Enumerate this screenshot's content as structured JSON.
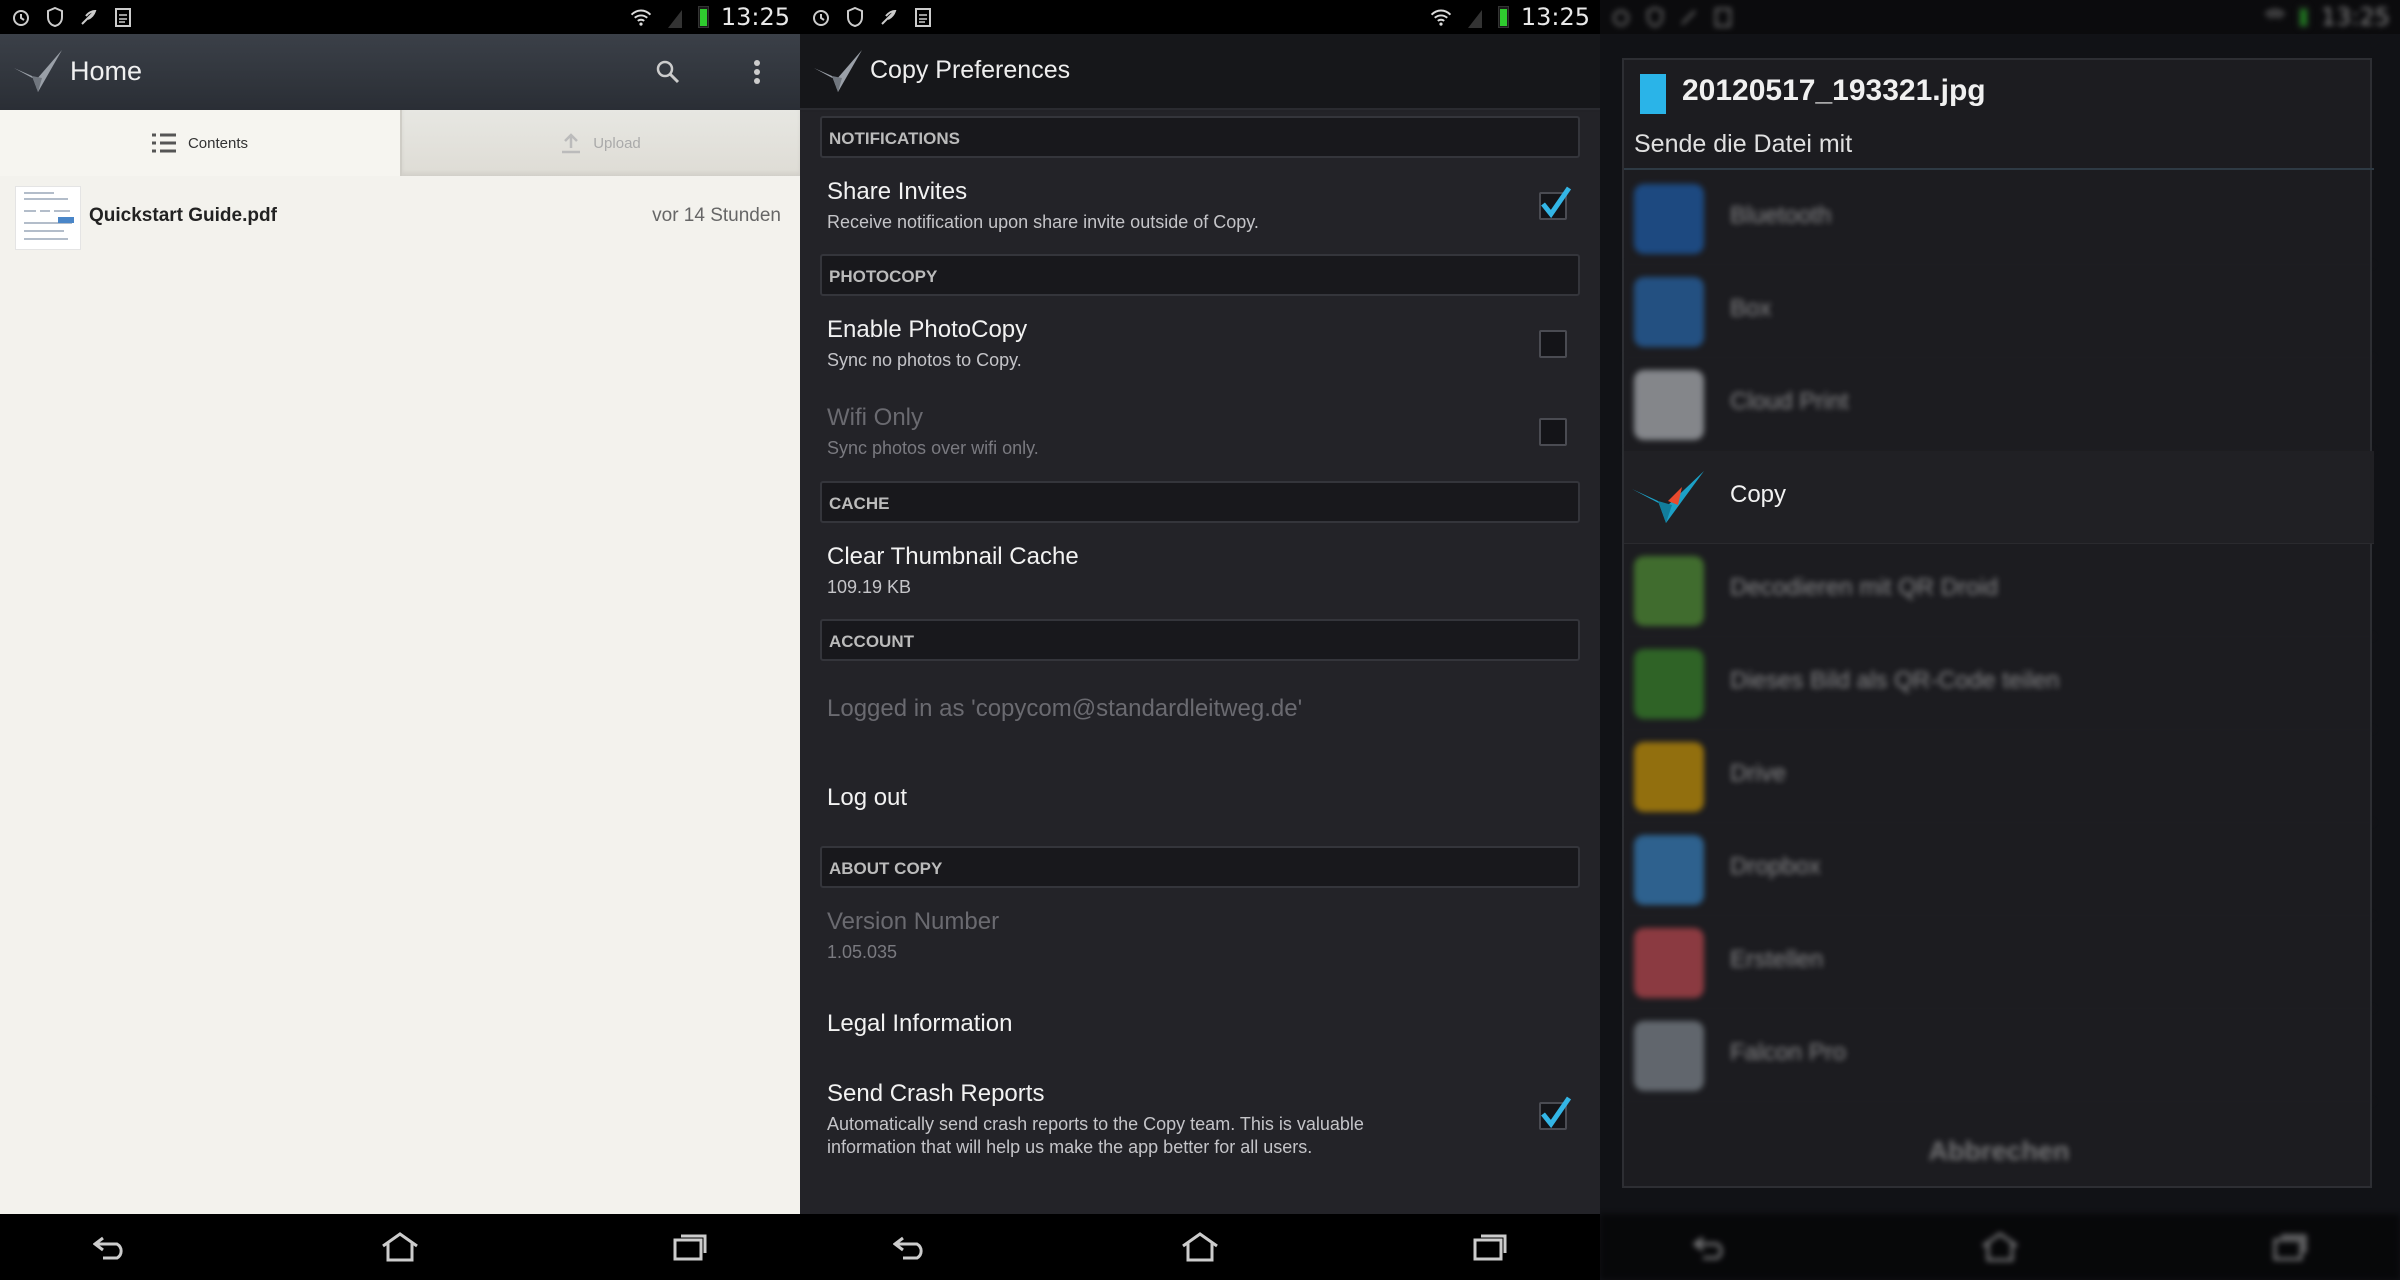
{
  "status": {
    "time": "13:25"
  },
  "home": {
    "title": "Home",
    "tabs": [
      {
        "label": "Contents",
        "icon": "list-icon",
        "active": true
      },
      {
        "label": "Upload",
        "icon": "upload-icon",
        "active": false
      }
    ],
    "files": [
      {
        "name": "Quickstart Guide.pdf",
        "time": "vor 14 Stunden"
      }
    ]
  },
  "prefs": {
    "title": "Copy Preferences",
    "sections": {
      "notifications": "NOTIFICATIONS",
      "photocopy": "PHOTOCOPY",
      "cache": "CACHE",
      "account": "ACCOUNT",
      "about": "ABOUT COPY"
    },
    "share_invites": {
      "title": "Share Invites",
      "summary": "Receive notification upon share invite outside of Copy.",
      "checked": true
    },
    "enable_photocopy": {
      "title": "Enable PhotoCopy",
      "summary": "Sync no photos to Copy.",
      "checked": false
    },
    "wifi_only": {
      "title": "Wifi Only",
      "summary": "Sync photos over wifi only.",
      "checked": false,
      "enabled": false
    },
    "clear_cache": {
      "title": "Clear Thumbnail Cache",
      "summary": "109.19 KB"
    },
    "logged_in": {
      "title": "Logged in as 'copycom@standardleitweg.de'"
    },
    "logout": {
      "title": "Log out"
    },
    "version": {
      "title": "Version Number",
      "summary": "1.05.035"
    },
    "legal": {
      "title": "Legal Information"
    },
    "crash_reports": {
      "title": "Send Crash Reports",
      "summary": "Automatically send crash reports to the Copy team. This is valuable information that will help us make the app better for all users.",
      "checked": true
    }
  },
  "share": {
    "file_title": "20120517_193321.jpg",
    "subtitle": "Sende die Datei mit",
    "apps": [
      {
        "label": "Bluetooth",
        "icon": "bluetooth-icon",
        "color": "#1e6fd0",
        "highlight": false
      },
      {
        "label": "Box",
        "icon": "box-icon",
        "color": "#2a7bd1",
        "highlight": false
      },
      {
        "label": "Cloud Print",
        "icon": "cloud-print-icon",
        "color": "#d9dde2",
        "highlight": false
      },
      {
        "label": "Copy",
        "icon": "copy-app-icon",
        "color": "#1ca0c6",
        "highlight": true
      },
      {
        "label": "Decodieren mit QR Droid",
        "icon": "qr-droid-icon",
        "color": "#5fae3a",
        "highlight": false
      },
      {
        "label": "Dieses Bild als QR-Code teilen",
        "icon": "qr-code-icon",
        "color": "#3f9e2c",
        "highlight": false
      },
      {
        "label": "Drive",
        "icon": "drive-icon",
        "color": "#f4b400",
        "highlight": false
      },
      {
        "label": "Dropbox",
        "icon": "dropbox-icon",
        "color": "#3d9ae8",
        "highlight": false
      },
      {
        "label": "Erstellen",
        "icon": "heart-icon",
        "color": "#e7545c",
        "highlight": false
      },
      {
        "label": "Falcon Pro",
        "icon": "falcon-icon",
        "color": "#9aa4ad",
        "highlight": false
      }
    ],
    "cancel": "Abbrechen"
  }
}
